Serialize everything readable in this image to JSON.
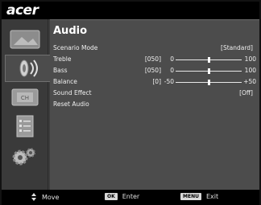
{
  "brand": "acer",
  "menu": {
    "title": "Audio",
    "items": [
      {
        "label": "Scenario Mode",
        "value": "[Standard]"
      },
      {
        "label": "Treble",
        "code": "[050]",
        "min": "0",
        "max": "100",
        "level": 0.5
      },
      {
        "label": "Bass",
        "code": "[050]",
        "min": "0",
        "max": "100",
        "level": 0.5
      },
      {
        "label": "Balance",
        "code": "[0]",
        "min": "-50",
        "max": "+50",
        "level": 0.5
      },
      {
        "label": "Sound Effect",
        "value": "[Off]"
      },
      {
        "label": "Reset Audio"
      }
    ]
  },
  "sidebar": {
    "tabs": [
      {
        "name": "picture-tab",
        "icon": "picture-icon",
        "active": false
      },
      {
        "name": "audio-tab",
        "icon": "speaker-icon",
        "active": true
      },
      {
        "name": "channel-tab",
        "icon": "ch-icon",
        "active": false
      },
      {
        "name": "setup-tab",
        "icon": "list-icon",
        "active": false
      },
      {
        "name": "settings-tab",
        "icon": "gear-icon",
        "active": false
      }
    ]
  },
  "footer": {
    "move_label": "Move",
    "ok_key": "OK",
    "enter_label": "Enter",
    "menu_key": "MENU",
    "exit_label": "Exit"
  },
  "colors": {
    "accent": "#ffffff",
    "panel": "#4c4c4c",
    "sidebar": "#3a3a3a",
    "bar": "#000000"
  }
}
